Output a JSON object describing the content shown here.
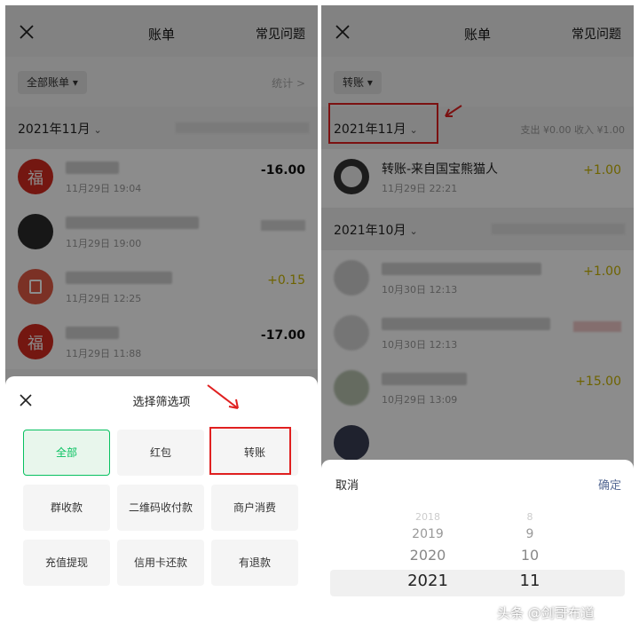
{
  "left": {
    "title": "账单",
    "faq": "常见问题",
    "filter_chip": "全部账单",
    "stat_link": "统计 >",
    "month": "2021年11月",
    "transactions": [
      {
        "date": "11月29日 19:04",
        "amount": "-16.00"
      },
      {
        "date": "11月29日 19:00",
        "amount": ""
      },
      {
        "date": "11月29日 12:25",
        "amount": "+0.15"
      },
      {
        "date": "11月29日 11:88",
        "amount": "-17.00"
      }
    ],
    "sheet": {
      "title": "选择筛选项",
      "options": [
        "全部",
        "红包",
        "转账",
        "群收款",
        "二维码收付款",
        "商户消费",
        "充值提现",
        "信用卡还款",
        "有退款"
      ],
      "selected": "全部",
      "highlighted": "转账"
    }
  },
  "right": {
    "title": "账单",
    "faq": "常见问题",
    "filter_chip": "转账",
    "month1": "2021年11月",
    "summary": "支出 ¥0.00  收入 ¥1.00",
    "transaction": {
      "title": "转账-来自国宝熊猫人",
      "date": "11月29日 22:21",
      "amount": "+1.00"
    },
    "month2": "2021年10月",
    "oct_rows": [
      {
        "date": "10月30日 12:13",
        "amount": "+1.00"
      },
      {
        "date": "10月30日 12:13",
        "amount": ""
      },
      {
        "date": "10月29日 13:09",
        "amount": "+15.00"
      }
    ],
    "picker": {
      "cancel": "取消",
      "confirm": "确定",
      "years": [
        "2018",
        "2019",
        "2020",
        "2021"
      ],
      "months": [
        "8",
        "9",
        "10",
        "11"
      ]
    }
  },
  "watermark": "头条 @剑哥布道",
  "colors": {
    "green": "#07c160",
    "red_annotation": "#e02020",
    "income": "#c9b500",
    "confirm": "#576b95"
  }
}
